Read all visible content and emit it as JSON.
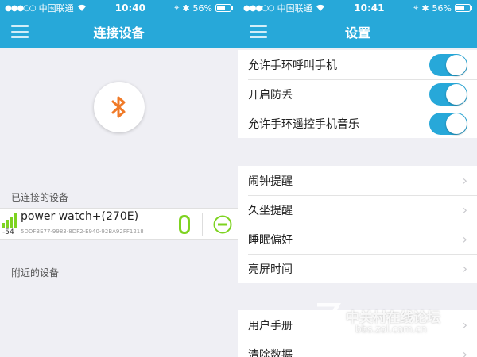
{
  "left": {
    "status": {
      "carrier": "中国联通",
      "time": "10:40",
      "battery": "56%"
    },
    "title": "连接设备",
    "connected_label": "已连接的设备",
    "nearby_label": "附近的设备",
    "device": {
      "name": "power watch+(270E)",
      "id": "5DDFBE77-9983-8DF2-E940-92BA92FF1218",
      "rssi": "-54"
    }
  },
  "right": {
    "status": {
      "carrier": "中国联通",
      "time": "10:41",
      "battery": "56%"
    },
    "title": "设置",
    "toggles": [
      {
        "label": "允许手环呼叫手机",
        "on": true
      },
      {
        "label": "开启防丢",
        "on": true
      },
      {
        "label": "允许手环遥控手机音乐",
        "on": true
      }
    ],
    "menu1": [
      {
        "label": "闹钟提醒"
      },
      {
        "label": "久坐提醒"
      },
      {
        "label": "睡眠偏好"
      },
      {
        "label": "亮屏时间"
      }
    ],
    "menu2": [
      {
        "label": "用户手册"
      },
      {
        "label": "清除数据"
      }
    ]
  },
  "watermark": {
    "text": "中关村在线论坛",
    "url": "bbs.zol.com.cn"
  },
  "colors": {
    "accent": "#27a8d9",
    "bluetooth": "#f07a28",
    "battery": "#7ed321",
    "remove": "#7ed321"
  }
}
